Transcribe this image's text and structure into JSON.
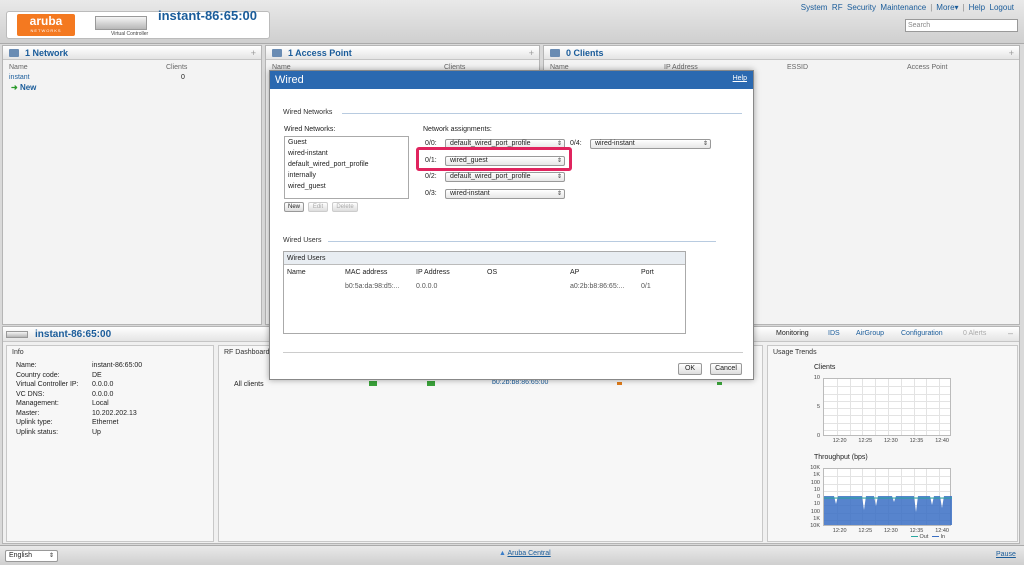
{
  "header": {
    "logo_text": "aruba",
    "logo_subtext": "NETWORKS",
    "vc_label": "Virtual Controller",
    "vc_name": "instant-86:65:00",
    "menu": [
      "System",
      "RF",
      "Security",
      "Maintenance",
      "More▾",
      "Help",
      "Logout"
    ],
    "search_placeholder": "Search",
    "brand_color": "#f47920",
    "link_color": "#1a5c9a"
  },
  "networks_panel": {
    "title": "1 Network",
    "plus": "+",
    "col_name": "Name",
    "col_clients": "Clients",
    "row_name": "instant",
    "row_clients": "0",
    "new_label": "New"
  },
  "ap_panel": {
    "title": "1 Access Point",
    "plus": "+",
    "col_name": "Name",
    "col_clients": "Clients"
  },
  "clients_panel": {
    "title": "0 Clients",
    "plus": "+",
    "col_name": "Name",
    "col_ip": "IP Address",
    "col_essid": "ESSID",
    "col_ap": "Access Point"
  },
  "bottom": {
    "title": "instant-86:65:00",
    "tabs": [
      "Monitoring",
      "IDS",
      "AirGroup",
      "Configuration",
      "0 Alerts"
    ],
    "minus": "–",
    "info": {
      "title": "Info",
      "rows": [
        [
          "Name:",
          "instant-86:65:00"
        ],
        [
          "Country code:",
          "DE"
        ],
        [
          "Virtual Controller IP:",
          "0.0.0.0"
        ],
        [
          "VC DNS:",
          "0.0.0.0"
        ],
        [
          "Management:",
          "Local"
        ],
        [
          "Master:",
          "10.202.202.13"
        ],
        [
          "Uplink type:",
          "Ethernet"
        ],
        [
          "Uplink status:",
          "Up"
        ]
      ]
    },
    "rf": {
      "title": "RF Dashboard",
      "all_clients": "All clients",
      "partial_mac": "b0:2b:b8:86:65:00"
    },
    "usage": {
      "title": "Usage Trends",
      "clients_title": "Clients",
      "throughput_title": "Throughput   (bps)",
      "legend_out": "Out",
      "legend_in": "In"
    }
  },
  "modal": {
    "title": "Wired",
    "help": "Help",
    "section_networks": "Wired Networks",
    "networks_label": "Wired Networks:",
    "networks": [
      "Guest",
      "wired-instant",
      "default_wired_port_profile",
      "internally",
      "wired_guest"
    ],
    "btn_new": "New",
    "btn_edit": "Edit",
    "btn_delete": "Delete",
    "assign_label": "Network assignments:",
    "ports": [
      {
        "port": "0/0:",
        "value": "default_wired_port_profile"
      },
      {
        "port": "0/1:",
        "value": "wired_guest"
      },
      {
        "port": "0/2:",
        "value": "default_wired_port_profile"
      },
      {
        "port": "0/3:",
        "value": "wired-instant"
      },
      {
        "port": "0/4:",
        "value": "wired-instant"
      }
    ],
    "section_users": "Wired Users",
    "users_box_title": "Wired Users",
    "user_columns": [
      "Name",
      "MAC address",
      "IP Address",
      "OS",
      "AP",
      "Port"
    ],
    "user_row": [
      "",
      "b0:5a:da:98:d5:...",
      "0.0.0.0",
      "",
      "a0:2b:b8:86:65:...",
      "0/1"
    ],
    "btn_ok": "OK",
    "btn_cancel": "Cancel",
    "highlight_color": "#e0245e"
  },
  "chart_data": [
    {
      "type": "line",
      "title": "Clients",
      "x": [
        "12:20",
        "12:25",
        "12:30",
        "12:35",
        "12:40"
      ],
      "yticks": [
        "10",
        "5",
        "0"
      ],
      "ylim": [
        0,
        10
      ],
      "series": [],
      "grid": true
    },
    {
      "type": "area",
      "title": "Throughput   (bps)",
      "x": [
        "12:20",
        "12:25",
        "12:30",
        "12:35",
        "12:40"
      ],
      "yticks": [
        "10K",
        "1K",
        "100",
        "10",
        "0",
        "10",
        "100",
        "1K",
        "10K"
      ],
      "series": [
        {
          "name": "Out",
          "values": [
            1,
            1,
            1,
            1,
            1
          ]
        },
        {
          "name": "In",
          "values": [
            1,
            1,
            1,
            1,
            1
          ]
        }
      ],
      "grid": true,
      "legend": "bottom-right"
    }
  ],
  "footer": {
    "language": "English",
    "center_link": "Aruba Central",
    "pause": "Pause"
  }
}
